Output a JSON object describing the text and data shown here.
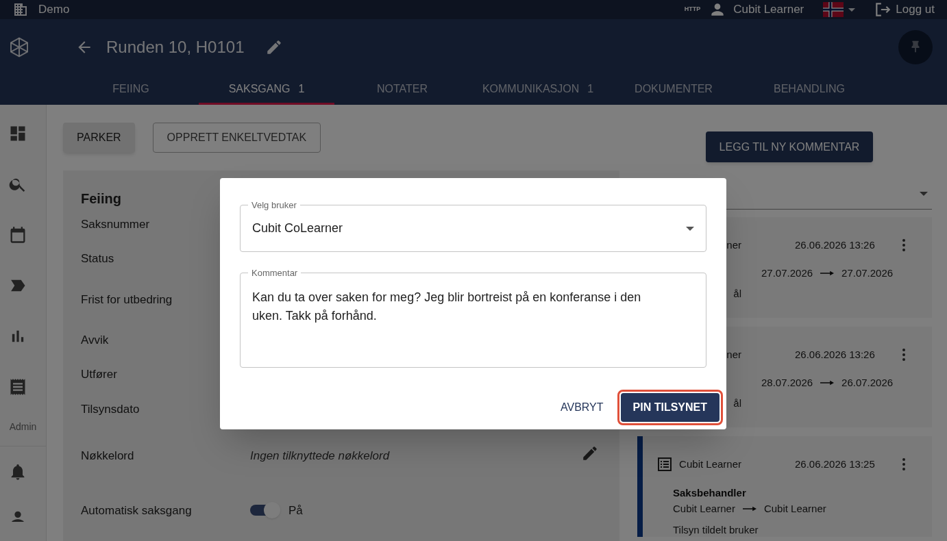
{
  "top_bar": {
    "app_name": "Demo",
    "protocol": "HTTP",
    "user": "Cubit Learner",
    "logout": "Logg ut"
  },
  "header": {
    "title": "Runden 10, H0101"
  },
  "tabs": [
    {
      "label": "FEIING",
      "selected": false
    },
    {
      "label": "SAKSGANG",
      "count": "1",
      "selected": true
    },
    {
      "label": "NOTATER",
      "selected": false
    },
    {
      "label": "KOMMUNIKASJON",
      "count": "1",
      "selected": false
    },
    {
      "label": "DOKUMENTER",
      "selected": false
    },
    {
      "label": "BEHANDLING",
      "selected": false
    }
  ],
  "sidebar": {
    "section_label": "Admin"
  },
  "actions": [
    {
      "label": "PARKER",
      "kind": "raised"
    },
    {
      "label": "OPPRETT ENKELTVEDTAK",
      "kind": "outlined"
    }
  ],
  "case_panel": {
    "title": "Feiing",
    "fields": [
      {
        "label": "Saksnummer",
        "kind": "plain"
      },
      {
        "label": "Status",
        "kind": "plain"
      },
      {
        "label": "Frist for utbedring",
        "kind": "plain"
      },
      {
        "label": "Avvik",
        "kind": "plain"
      },
      {
        "label": "Utfører",
        "kind": "plain"
      },
      {
        "label": "Tilsynsdato",
        "kind": "plain"
      },
      {
        "label": "Nøkkelord",
        "kind": "keywords",
        "value": "Ingen tilknyttede nøkkelord"
      },
      {
        "label": "Automatisk saksgang",
        "kind": "toggle",
        "on": true,
        "value": "På"
      }
    ]
  },
  "comments": {
    "add_button": "LEGG TIL NY KOMMENTAR",
    "entries": [
      {
        "kind": "change",
        "author": "ner",
        "time": "26.06.2026 13:26",
        "from": "27.07.2026",
        "to": "27.07.2026",
        "note": "ål"
      },
      {
        "kind": "change",
        "author": "ner",
        "time": "26.06.2026 13:26",
        "from": "28.07.2026",
        "to": "26.07.2026",
        "note": "ål"
      },
      {
        "kind": "assignment",
        "author": "Cubit Learner",
        "time": "26.06.2026 13:25",
        "heading": "Saksbehandler",
        "from": "Cubit Learner",
        "to": "Cubit Learner",
        "note": "Tilsyn tildelt bruker",
        "highlighted": true
      }
    ]
  },
  "dialog": {
    "user_field": {
      "label": "Velg bruker",
      "value": "Cubit CoLearner"
    },
    "comment_field": {
      "label": "Kommentar",
      "value": "Kan du ta over saken for meg? Jeg blir bortreist på en konferanse i den uken. Takk på forhånd."
    },
    "cancel": "AVBRYT",
    "confirm": "PIN TILSYNET"
  }
}
